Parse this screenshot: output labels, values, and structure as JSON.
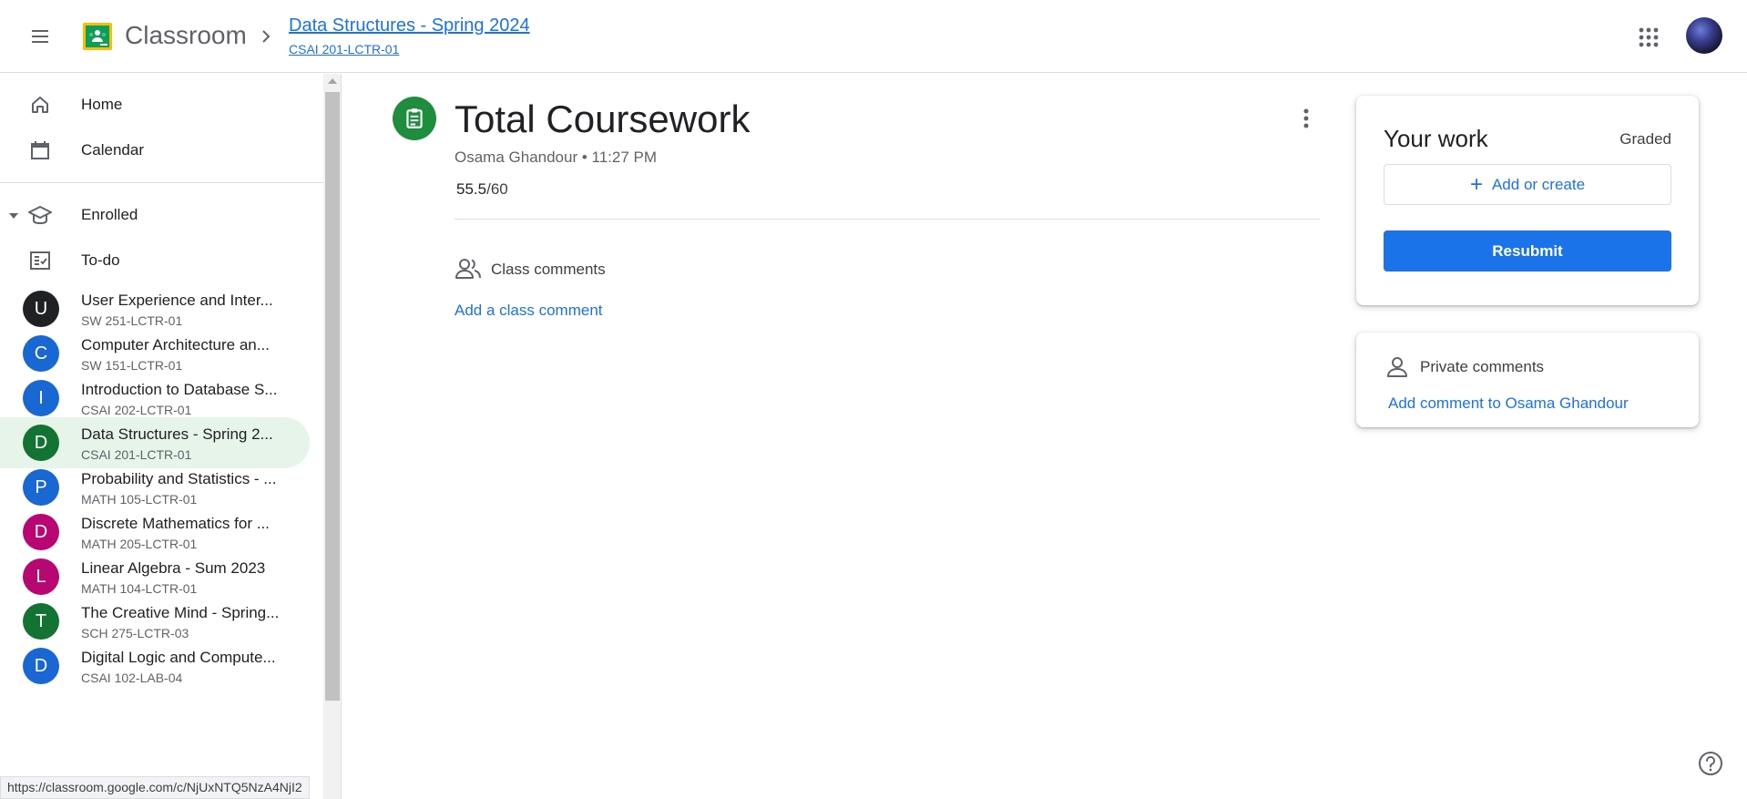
{
  "app": {
    "name": "Classroom",
    "icons": {
      "menu": "hamburger-menu-icon",
      "logo": "classroom-logo-icon",
      "apps": "google-apps-grid-icon"
    }
  },
  "breadcrumb": {
    "course_title": "Data Structures - Spring 2024",
    "course_code": "CSAI 201-LCTR-01"
  },
  "sidebar": {
    "nav": [
      {
        "label": "Home",
        "icon": "home-icon"
      },
      {
        "label": "Calendar",
        "icon": "calendar-icon"
      }
    ],
    "enrolled": {
      "label": "Enrolled",
      "icon": "graduation-cap-icon"
    },
    "todo": {
      "label": "To-do",
      "icon": "todo-checklist-icon"
    },
    "courses": [
      {
        "initial": "U",
        "name": "User Experience and Inter...",
        "code": "SW 251-LCTR-01",
        "color": "#202124"
      },
      {
        "initial": "C",
        "name": "Computer Architecture an...",
        "code": "SW 151-LCTR-01",
        "color": "#1967d2"
      },
      {
        "initial": "I",
        "name": "Introduction to Database S...",
        "code": "CSAI 202-LCTR-01",
        "color": "#1967d2"
      },
      {
        "initial": "D",
        "name": "Data Structures - Spring 2...",
        "code": "CSAI 201-LCTR-01",
        "color": "#137333",
        "active": true
      },
      {
        "initial": "P",
        "name": "Probability and Statistics - ...",
        "code": "MATH 105-LCTR-01",
        "color": "#1967d2"
      },
      {
        "initial": "D",
        "name": "Discrete Mathematics for ...",
        "code": "MATH 205-LCTR-01",
        "color": "#b80672"
      },
      {
        "initial": "L",
        "name": "Linear Algebra - Sum 2023",
        "code": "MATH 104-LCTR-01",
        "color": "#b80672"
      },
      {
        "initial": "T",
        "name": "The Creative Mind - Spring...",
        "code": "SCH 275-LCTR-03",
        "color": "#137333"
      },
      {
        "initial": "D",
        "name": "Digital Logic and Compute...",
        "code": "CSAI 102-LAB-04",
        "color": "#1967d2"
      }
    ]
  },
  "status_bar": {
    "url": "https://classroom.google.com/c/NjUxNTQ5NzA4NjI2"
  },
  "assignment": {
    "icon": "assignment-clipboard-icon",
    "title": "Total Coursework",
    "meta": "Osama Ghandour • 11:27 PM",
    "points_earned": "55.5",
    "points_total": "/60",
    "class_comments": {
      "label": "Class comments",
      "add_label": "Add a class comment",
      "icon": "people-icon"
    }
  },
  "your_work": {
    "title": "Your work",
    "status": "Graded",
    "add_create_label": "Add or create",
    "resubmit_label": "Resubmit"
  },
  "private_comments": {
    "label": "Private comments",
    "add_label": "Add comment to Osama Ghandour",
    "icon": "person-icon"
  },
  "colors": {
    "accent": "#1a73e8",
    "assignment_icon_bg": "#1e8e3e",
    "active_course_bg": "#e6f4ea"
  }
}
